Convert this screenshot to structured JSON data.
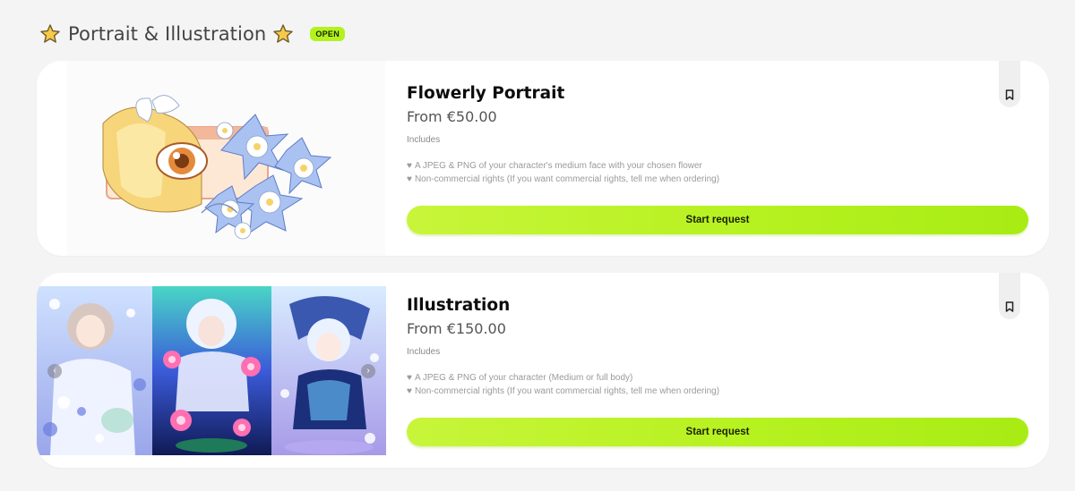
{
  "section": {
    "title": "Portrait & Illustration",
    "status_badge": "OPEN",
    "star_icon": "star-icon"
  },
  "colors": {
    "page_bg": "#f4f4f5",
    "card_bg": "#ffffff",
    "accent": "#b3f21f",
    "text_primary": "#0c0c0c",
    "text_muted": "#9a9a9a"
  },
  "cards": [
    {
      "title": "Flowerly Portrait",
      "price": "From €50.00",
      "includes_label": "Includes",
      "features": [
        "A JPEG & PNG of your character's medium face with your chosen flower",
        "Non-commercial rights (If you want commercial rights, tell me when ordering)"
      ],
      "cta_label": "Start request",
      "bookmark_icon": "bookmark-icon"
    },
    {
      "title": "Illustration",
      "price": "From €150.00",
      "includes_label": "Includes",
      "features": [
        "A JPEG & PNG of your character (Medium or full body)",
        "Non-commercial rights (If you want commercial rights, tell me when ordering)"
      ],
      "cta_label": "Start request",
      "bookmark_icon": "bookmark-icon",
      "carousel": {
        "prev_icon": "chevron-left-icon",
        "next_icon": "chevron-right-icon",
        "prev_glyph": "‹",
        "next_glyph": "›"
      }
    }
  ]
}
